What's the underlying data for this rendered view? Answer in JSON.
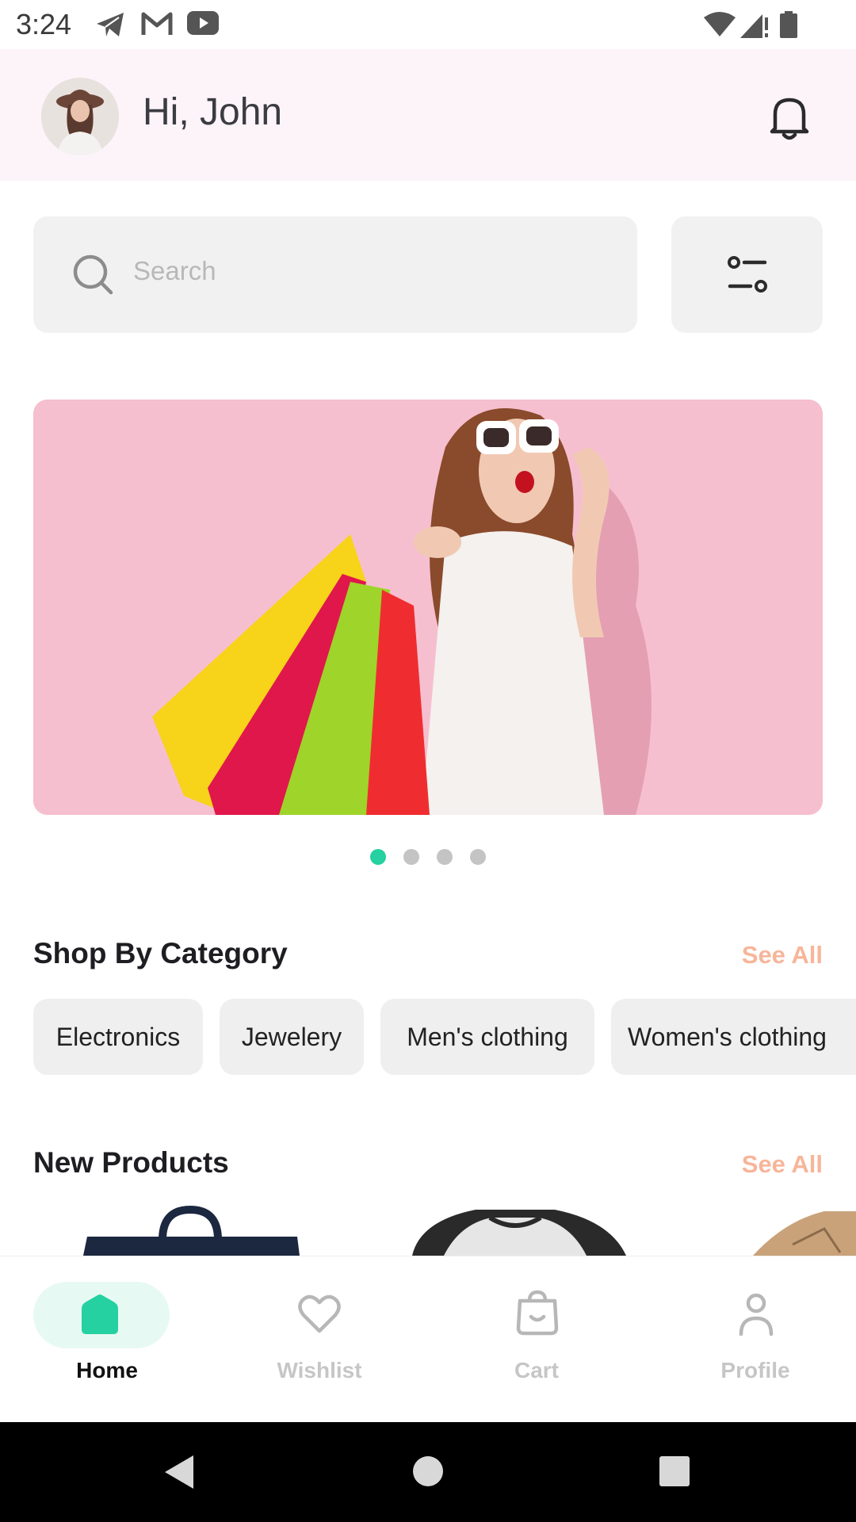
{
  "status_bar": {
    "time": "3:24",
    "left_icons": [
      "telegram-icon",
      "gmail-icon",
      "youtube-icon"
    ],
    "right_icons": [
      "wifi-icon",
      "signal-icon",
      "battery-icon"
    ]
  },
  "header": {
    "greeting": "Hi, John",
    "avatar": "avatar",
    "notification_icon": "bell-icon"
  },
  "search": {
    "placeholder": "Search",
    "filter_icon": "filter-icon"
  },
  "banner": {
    "pages": 4,
    "active_page": 1,
    "accent_color": "#25d1a0"
  },
  "categories": {
    "title": "Shop By Category",
    "see_all": "See All",
    "items": [
      "Electronics",
      "Jewelery",
      "Men's clothing",
      "Women's clothing"
    ]
  },
  "new_products": {
    "title": "New Products",
    "see_all": "See All"
  },
  "bottom_nav": {
    "items": [
      {
        "label": "Home",
        "icon": "home-icon",
        "active": true
      },
      {
        "label": "Wishlist",
        "icon": "heart-icon",
        "active": false
      },
      {
        "label": "Cart",
        "icon": "bag-icon",
        "active": false
      },
      {
        "label": "Profile",
        "icon": "user-icon",
        "active": false
      }
    ]
  },
  "colors": {
    "accent": "#25d1a0",
    "see_all": "#f7b59a",
    "header_bg": "#fdf4fa",
    "banner_bg": "#f6bfcf"
  }
}
